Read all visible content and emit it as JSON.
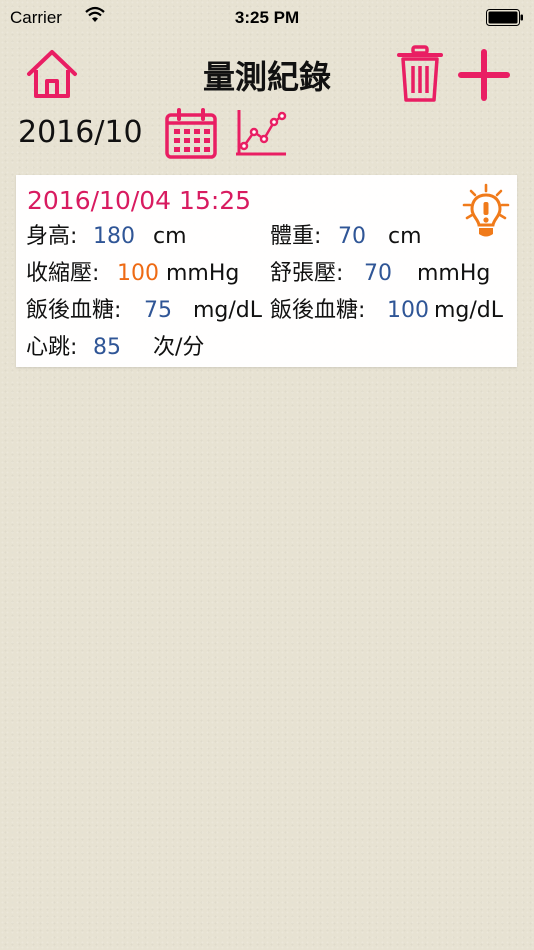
{
  "status_bar": {
    "carrier": "Carrier",
    "time": "3:25 PM"
  },
  "nav": {
    "title": "量測紀錄",
    "home_icon": "home-icon",
    "trash_icon": "trash-icon",
    "add_icon": "plus-icon"
  },
  "toolbar": {
    "month": "2016/10",
    "calendar_icon": "calendar-icon",
    "chart_icon": "line-chart-icon"
  },
  "colors": {
    "accent": "#e91e63",
    "value": "#2f5596",
    "warning": "#ee6a14",
    "datetime": "#d81b60"
  },
  "records": [
    {
      "datetime": "2016/10/04 15:25",
      "alert_icon": "lightbulb-alert-icon",
      "height": {
        "label": "身高:",
        "value": "180",
        "unit": "cm"
      },
      "weight": {
        "label": "體重:",
        "value": "70",
        "unit": "cm"
      },
      "systolic": {
        "label": "收縮壓:",
        "value": "100",
        "unit": "mmHg"
      },
      "diastolic": {
        "label": "舒張壓:",
        "value": "70",
        "unit": "mmHg"
      },
      "glucose_1": {
        "label": "飯後血糖:",
        "value": "75",
        "unit": "mg/dL"
      },
      "glucose_2": {
        "label": "飯後血糖:",
        "value": "100",
        "unit": "mg/dL"
      },
      "heart_rate": {
        "label": "心跳:",
        "value": "85",
        "unit": "次/分"
      }
    }
  ]
}
